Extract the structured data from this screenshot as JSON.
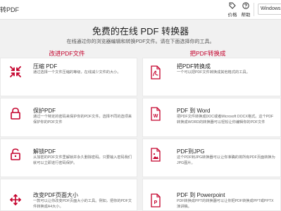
{
  "topbar": {
    "brand": "转PDF",
    "price_label": "价格",
    "help_label": "帮助",
    "os_label": "Windows"
  },
  "hero": {
    "title": "免费的在线 PDF 转换器",
    "subtitle": "在线通过你的浏览器编辑和转换PDF文件。请在下面选择你的工具。"
  },
  "columns": {
    "left_heading": "改进PDF文件",
    "right_heading": "把PDF转换成"
  },
  "left_tools": [
    {
      "title": "压缩 PDF",
      "desc": "通过选择一个文件压缩的等级，在线减少文件的大小。",
      "icon": "compress-icon"
    },
    {
      "title": "保护PDF",
      "desc": "通过一个特定的密码来保护你的PDF文件。选择不同的选项来保护你的PDF文件",
      "icon": "lock-icon"
    },
    {
      "title": "解锁PDF",
      "desc": "从加密的PDF文件里解锁并永久删除密码。只要输入密码我们就可以立即进行密码保护。",
      "icon": "unlock-icon"
    },
    {
      "title": "改变PDF页面大小",
      "desc": "一款可以让你改变PDF页面大小的工具。例如，把你的PDF文件转换成A4大小。",
      "icon": "resize-icon"
    }
  ],
  "right_tools": [
    {
      "title": "把PDF转换成",
      "desc": "一个可以把PDF文件转换成其他格式的工具。",
      "icon": "pdf-file-icon"
    },
    {
      "title": "PDF 到 Word",
      "desc": "把PDF文件转换成DOC或者Microsoft DOCX格式。这个PDF转换成WORD的转换器可以轻松让你编辑你的PDF文件",
      "icon": "word-file-icon"
    },
    {
      "title": "PDF到JPG",
      "desc": "这个PDF到JPG转换器可以让你准确的将所有PDF页面转换为JPG图片。",
      "icon": "image-file-icon"
    },
    {
      "title": "PDF 到 Powerpoint",
      "desc": "PDF转换成PPT的转换器可以让你把PDF转换成PPT或PPTX演讲稿。",
      "icon": "powerpoint-file-icon"
    }
  ],
  "colors": {
    "accent": "#c4002b",
    "icon_red": "#c4002b"
  }
}
